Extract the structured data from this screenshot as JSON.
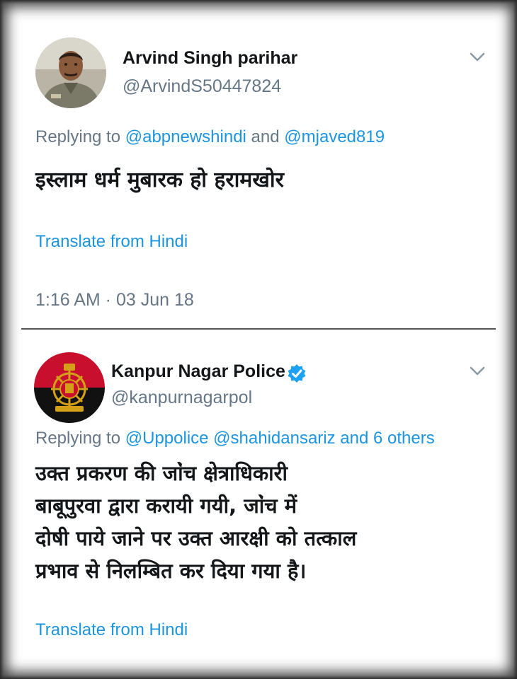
{
  "tweets": [
    {
      "name": "Arvind Singh parihar",
      "handle": "@ArvindS50447824",
      "replying_prefix": "Replying to ",
      "mention_1": "@abpnewshindi",
      "joiner": " and ",
      "mention_2": "@mjaved819",
      "body": "इस्लाम धर्म मुबारक हो हरामखोर",
      "translate": "Translate from Hindi",
      "timestamp": "1:16 AM · 03 Jun 18"
    },
    {
      "name": "Kanpur Nagar Police",
      "handle": "@kanpurnagarpol",
      "verified": true,
      "replying_prefix": "Replying to ",
      "mentions": "@Uppolice @shahidansariz and 6 others",
      "body_lines": [
        "उक्त प्रकरण की जा॓ंच क्षेत्राधिकारी",
        "बाबूपुरवा द्वारा करायी गयी, जा॓ंच में",
        "दोषी पाये जाने पर उक्त आरक्षी को तत्काल",
        "प्रभाव से निलम्बित कर दिया गया है।"
      ],
      "translate": "Translate from Hindi"
    }
  ],
  "icons": {
    "menu": "chevron-down-icon",
    "verified": "verified-badge-icon"
  },
  "colors": {
    "link": "#1b95e0",
    "secondary_text": "#657786",
    "primary_text": "#14171a",
    "verified": "#1da1f2",
    "police_avatar_red": "#c8102e"
  }
}
